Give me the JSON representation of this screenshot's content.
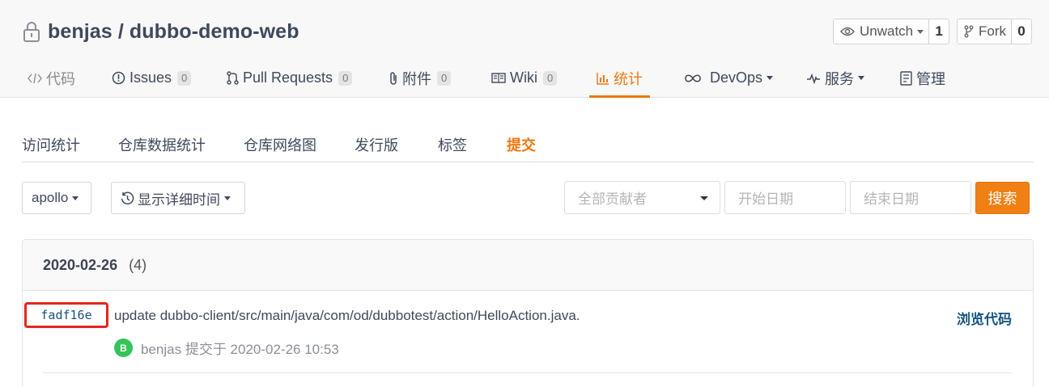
{
  "repo": {
    "owner": "benjas",
    "separator": "/",
    "name": "dubbo-demo-web"
  },
  "watch": {
    "label": "Unwatch",
    "count": "1"
  },
  "fork": {
    "label": "Fork",
    "count": "0"
  },
  "nav": {
    "code": "代码",
    "issues": {
      "label": "Issues",
      "count": "0"
    },
    "pulls": {
      "label": "Pull Requests",
      "count": "0"
    },
    "attachments": {
      "label": "附件",
      "count": "0"
    },
    "wiki": {
      "label": "Wiki",
      "count": "0"
    },
    "stats": "统计",
    "devops": "DevOps",
    "services": "服务",
    "manage": "管理"
  },
  "subnav": [
    "访问统计",
    "仓库数据统计",
    "仓库网络图",
    "发行版",
    "标签",
    "提交"
  ],
  "filters": {
    "branch": "apollo",
    "time_mode": "显示详细时间",
    "contributors_placeholder": "全部贡献者",
    "start_placeholder": "开始日期",
    "end_placeholder": "结束日期",
    "search_label": "搜索"
  },
  "commit_group": {
    "date": "2020-02-26",
    "count": "(4)",
    "commits": [
      {
        "sha": "fadf16e",
        "message": "update dubbo-client/src/main/java/com/od/dubbotest/action/HelloAction.java.",
        "browse_label": "浏览代码",
        "avatar_letter": "B",
        "author_line": "benjas 提交于 2020-02-26 10:53"
      }
    ]
  },
  "colors": {
    "accent": "#f0780f",
    "link": "#175584",
    "highlight_box": "#e3261f",
    "avatar": "#35c45a"
  }
}
